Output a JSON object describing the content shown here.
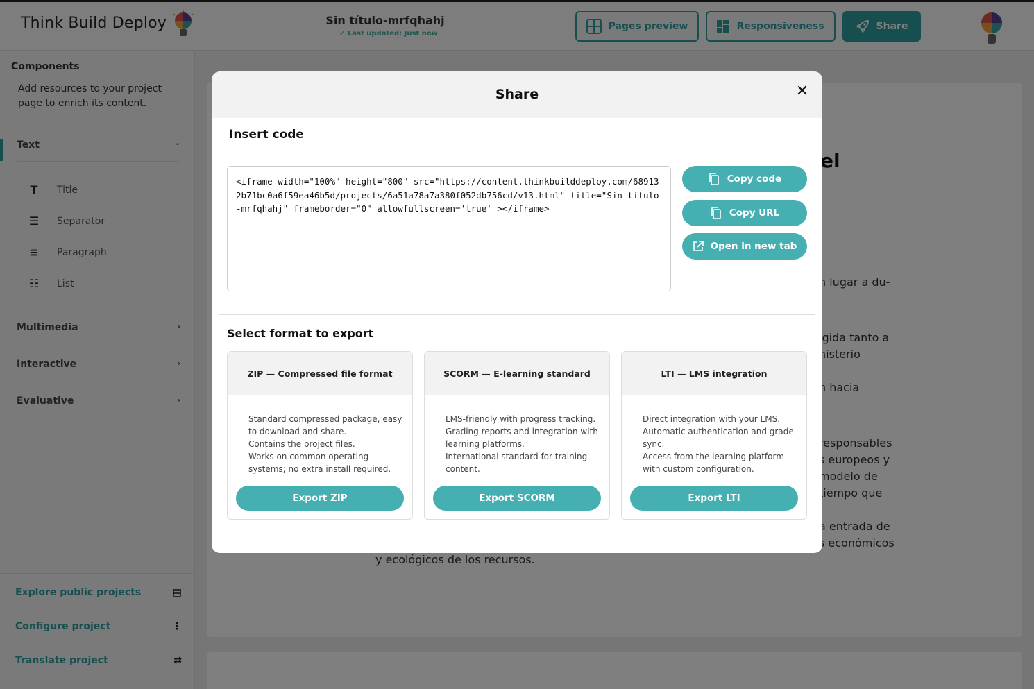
{
  "header": {
    "brand": "Think Build Deploy",
    "doc_title": "Sin título-mrfqhahj",
    "last_updated": "✓ Last updated: Just now",
    "buttons": {
      "pages_preview": "Pages preview",
      "responsiveness": "Responsiveness",
      "share": "Share"
    }
  },
  "sidebar": {
    "heading": "Components",
    "description": "Add resources to your project page to enrich its content.",
    "sections": {
      "text": "Text",
      "multimedia": "Multimedia",
      "interactive": "Interactive",
      "evaluative": "Evaluative"
    },
    "text_items": [
      "Title",
      "Separator",
      "Paragraph",
      "List"
    ],
    "footer": {
      "explore": "Explore public projects",
      "configure": "Configure project",
      "translate": "Translate project"
    }
  },
  "background": {
    "heading_fragment": "el",
    "lines": [
      "n lugar a du-",
      "igida tanto a",
      "nisterio",
      "n hacia",
      "responsables",
      "s europeos y",
      "modelo de",
      "tiempo que",
      "a entrada de",
      "s económicos",
      "y ecológicos de los recursos."
    ]
  },
  "modal": {
    "title": "Share",
    "close": "✕",
    "insert_code_title": "Insert code",
    "code": "<iframe width=\"100%\" height=\"800\" src=\"https://content.thinkbuilddeploy.com/689132b71bc0a6f59ea46b5d/projects/6a51a78a7a380f052db756cd/v13.html\" title=\"Sin título-mrfqhahj\" frameborder=\"0\" allowfullscreen='true' ></iframe>",
    "buttons": {
      "copy_code": "Copy code",
      "copy_url": "Copy URL",
      "open_new_tab": "Open in new tab"
    },
    "export_title": "Select format to export",
    "formats": [
      {
        "title": "ZIP — Compressed file format",
        "lines": [
          "Standard compressed package, easy to download and share.",
          "Contains the project files.",
          "Works on common operating systems; no extra install required."
        ],
        "button": "Export ZIP"
      },
      {
        "title": "SCORM — E-learning standard",
        "lines": [
          "LMS-friendly with progress tracking.",
          "Grading reports and integration with learning platforms.",
          "International standard for training content."
        ],
        "button": "Export SCORM"
      },
      {
        "title": "LTI — LMS integration",
        "lines": [
          "Direct integration with your LMS.",
          "Automatic authentication and grade sync.",
          "Access from the learning platform with custom configuration."
        ],
        "button": "Export LTI"
      }
    ]
  },
  "colors": {
    "accent": "#2f9ea1",
    "button": "#45afb2",
    "overlay": "rgba(0,0,0,0.5)"
  }
}
